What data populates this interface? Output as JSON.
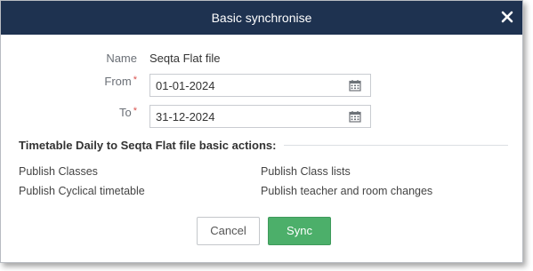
{
  "dialog": {
    "title": "Basic synchronise",
    "close_icon": "close-icon"
  },
  "form": {
    "name_label": "Name",
    "name_value": "Seqta Flat file",
    "from_label": "From",
    "from_value": "01-01-2024",
    "to_label": "To",
    "to_value": "31-12-2024",
    "required_marker": "*",
    "calendar_icon": "calendar-icon"
  },
  "actions_section": {
    "title": "Timetable Daily to Seqta Flat file basic actions:",
    "items": [
      "Publish Classes",
      "Publish Class lists",
      "Publish Cyclical timetable",
      "Publish teacher and room changes"
    ]
  },
  "buttons": {
    "cancel_label": "Cancel",
    "sync_label": "Sync"
  },
  "colors": {
    "titlebar": "#1e3250",
    "sync_button": "#4caf6a",
    "required": "#d9534f"
  }
}
